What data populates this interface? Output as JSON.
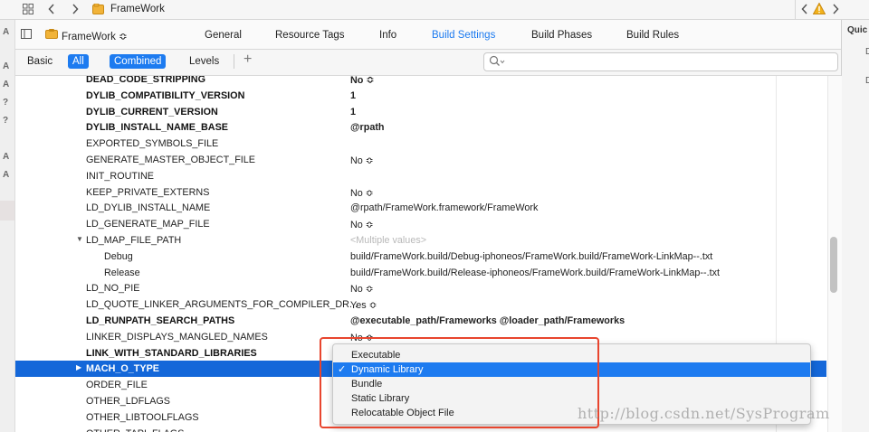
{
  "navbar": {
    "grid_icon": "grid-icon",
    "title": "FrameWork",
    "warning_icon": "warning-icon"
  },
  "gutter_letters": [
    "A",
    "A",
    "A",
    "?",
    "?",
    "A",
    "A"
  ],
  "inspector": {
    "label": "Quic",
    "items": [
      "D",
      "D"
    ]
  },
  "tabbar": {
    "target": "FrameWork",
    "tabs": [
      "General",
      "Resource Tags",
      "Info",
      "Build Settings",
      "Build Phases",
      "Build Rules"
    ],
    "active_tab": "Build Settings",
    "accent": "#1d7bf0"
  },
  "filterbar": {
    "basic": "Basic",
    "all": "All",
    "combined": "Combined",
    "levels": "Levels",
    "add": "+",
    "search_placeholder": ""
  },
  "rows": [
    {
      "name": "DEAD_CODE_STRIPPING",
      "value": "No ≎",
      "bold": true,
      "vbold": true
    },
    {
      "name": "DYLIB_COMPATIBILITY_VERSION",
      "value": "1",
      "bold": true,
      "vbold": true
    },
    {
      "name": "DYLIB_CURRENT_VERSION",
      "value": "1",
      "bold": true,
      "vbold": true
    },
    {
      "name": "DYLIB_INSTALL_NAME_BASE",
      "value": "@rpath",
      "bold": true,
      "vbold": true
    },
    {
      "name": "EXPORTED_SYMBOLS_FILE",
      "value": ""
    },
    {
      "name": "GENERATE_MASTER_OBJECT_FILE",
      "value": "No ≎"
    },
    {
      "name": "INIT_ROUTINE",
      "value": ""
    },
    {
      "name": "KEEP_PRIVATE_EXTERNS",
      "value": "No ≎"
    },
    {
      "name": "LD_DYLIB_INSTALL_NAME",
      "value": "@rpath/FrameWork.framework/FrameWork"
    },
    {
      "name": "LD_GENERATE_MAP_FILE",
      "value": "No ≎"
    },
    {
      "name": "LD_MAP_FILE_PATH",
      "value": "<Multiple values>",
      "muted": true,
      "expanded": true
    },
    {
      "name": "Debug",
      "value": "build/FrameWork.build/Debug-iphoneos/FrameWork.build/FrameWork-LinkMap--.txt",
      "child": true
    },
    {
      "name": "Release",
      "value": "build/FrameWork.build/Release-iphoneos/FrameWork.build/FrameWork-LinkMap--.txt",
      "child": true
    },
    {
      "name": "LD_NO_PIE",
      "value": "No ≎"
    },
    {
      "name": "LD_QUOTE_LINKER_ARGUMENTS_FOR_COMPILER_DR...",
      "value": "Yes ≎"
    },
    {
      "name": "LD_RUNPATH_SEARCH_PATHS",
      "value": "@executable_path/Frameworks @loader_path/Frameworks",
      "bold": true,
      "vbold": true
    },
    {
      "name": "LINKER_DISPLAYS_MANGLED_NAMES",
      "value": "No ≎"
    },
    {
      "name": "LINK_WITH_STANDARD_LIBRARIES",
      "value": "",
      "bold": true
    },
    {
      "name": "MACH_O_TYPE",
      "value": "",
      "bold": true,
      "selected": true,
      "collapsed": true
    },
    {
      "name": "ORDER_FILE",
      "value": ""
    },
    {
      "name": "OTHER_LDFLAGS",
      "value": ""
    },
    {
      "name": "OTHER_LIBTOOLFLAGS",
      "value": ""
    },
    {
      "name": "OTHER_TAPI_FLAGS",
      "value": ""
    }
  ],
  "popup": {
    "options": [
      "Executable",
      "Dynamic Library",
      "Bundle",
      "Static Library",
      "Relocatable Object File"
    ],
    "selected": "Dynamic Library",
    "check": "✓"
  },
  "watermark": "http://blog.csdn.net/SysProgram",
  "colors": {
    "selection": "#1467d9",
    "highlight": "#1d7bf0",
    "annotation": "#e8452e"
  }
}
